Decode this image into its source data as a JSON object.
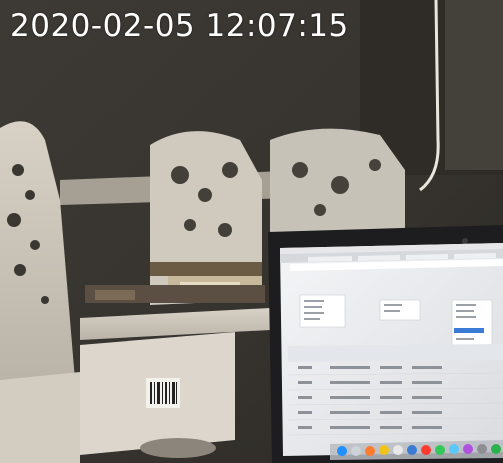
{
  "overlay": {
    "timestamp": "2020-02-05 12:07:15"
  },
  "scene": {
    "objects": [
      "shelf",
      "decorative-bookend-left",
      "decorative-bookend-center",
      "decorative-bookend-right",
      "book-stack",
      "storage-box",
      "barcode-label",
      "laptop",
      "browser-window",
      "dock"
    ]
  },
  "colors": {
    "wall": "#3a3733",
    "shelf": "#d8d2c8",
    "screen": "#f2f3f5",
    "table_header": "#e3e6ea"
  }
}
